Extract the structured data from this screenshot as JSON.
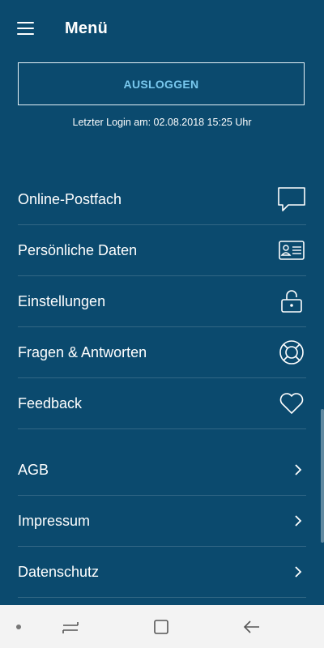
{
  "header": {
    "title": "Menü",
    "menu_icon": "hamburger-icon"
  },
  "logout": {
    "label": "AUSLOGGEN"
  },
  "last_login": {
    "text": "Letzter Login am:  02.08.2018  15:25  Uhr"
  },
  "menu": [
    {
      "label": "Online-Postfach",
      "icon": "chat-bubble-icon"
    },
    {
      "label": "Persönliche  Daten",
      "icon": "id-card-icon"
    },
    {
      "label": "Einstellungen",
      "icon": "lock-icon"
    },
    {
      "label": "Fragen & Antworten",
      "icon": "lifebuoy-icon"
    },
    {
      "label": "Feedback",
      "icon": "heart-icon"
    }
  ],
  "links": [
    {
      "label": "AGB",
      "icon": "chevron-right-icon"
    },
    {
      "label": "Impressum",
      "icon": "chevron-right-icon"
    },
    {
      "label": "Datenschutz",
      "icon": "chevron-right-icon"
    }
  ],
  "system_nav": [
    "dot-icon",
    "recents-icon",
    "home-icon",
    "back-icon"
  ],
  "colors": {
    "background": "#0b4a6e",
    "accent": "#79c8ee",
    "navbar": "#f3f3f3"
  }
}
